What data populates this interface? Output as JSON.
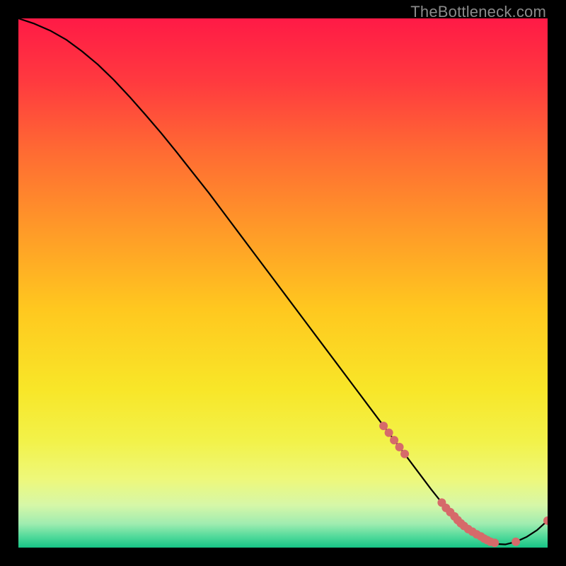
{
  "watermark": "TheBottleneck.com",
  "chart_data": {
    "type": "line",
    "title": "",
    "xlabel": "",
    "ylabel": "",
    "xlim": [
      0,
      100
    ],
    "ylim": [
      0,
      100
    ],
    "grid": false,
    "series": [
      {
        "name": "bottleneck-curve",
        "color": "#000000",
        "x": [
          0,
          3,
          6,
          9,
          12,
          15,
          18,
          21,
          24,
          27,
          30,
          33,
          36,
          39,
          42,
          45,
          48,
          51,
          54,
          57,
          60,
          63,
          66,
          69,
          72,
          75,
          78,
          80,
          82,
          84,
          86,
          88,
          90,
          92,
          94,
          96,
          98,
          100
        ],
        "y": [
          100,
          99,
          97.7,
          96,
          93.8,
          91.3,
          88.4,
          85.2,
          81.8,
          78.3,
          74.6,
          70.8,
          67,
          63,
          59,
          55,
          51,
          47,
          43,
          39,
          35,
          31,
          27,
          23,
          19,
          15,
          11,
          8.5,
          6.2,
          4.2,
          2.6,
          1.4,
          0.7,
          0.6,
          1.1,
          2.0,
          3.3,
          5.1
        ]
      },
      {
        "name": "highlight-points",
        "color": "#d66a6a",
        "x": [
          69,
          70,
          71,
          72,
          73,
          80,
          80.8,
          81.6,
          82.4,
          83,
          83.6,
          84.2,
          85,
          85.8,
          86.6,
          87.4,
          88,
          88.6,
          89.2,
          90,
          94,
          100
        ],
        "y": [
          23,
          21.7,
          20.3,
          19,
          17.7,
          8.5,
          7.5,
          6.7,
          5.9,
          5.2,
          4.6,
          4.1,
          3.5,
          3.0,
          2.5,
          2.1,
          1.7,
          1.4,
          1.1,
          0.9,
          1.1,
          5.1
        ]
      }
    ],
    "background_gradient": {
      "direction": "vertical",
      "stops": [
        {
          "offset": 0.0,
          "color": "#ff1a46"
        },
        {
          "offset": 0.12,
          "color": "#ff3a3f"
        },
        {
          "offset": 0.25,
          "color": "#ff6a33"
        },
        {
          "offset": 0.4,
          "color": "#ff9a28"
        },
        {
          "offset": 0.55,
          "color": "#ffc81f"
        },
        {
          "offset": 0.7,
          "color": "#f8e628"
        },
        {
          "offset": 0.8,
          "color": "#f2f24a"
        },
        {
          "offset": 0.87,
          "color": "#eef87a"
        },
        {
          "offset": 0.92,
          "color": "#d6f7a8"
        },
        {
          "offset": 0.955,
          "color": "#9fecb0"
        },
        {
          "offset": 0.98,
          "color": "#4fd99a"
        },
        {
          "offset": 1.0,
          "color": "#17c486"
        }
      ]
    },
    "point_radius": 6
  }
}
